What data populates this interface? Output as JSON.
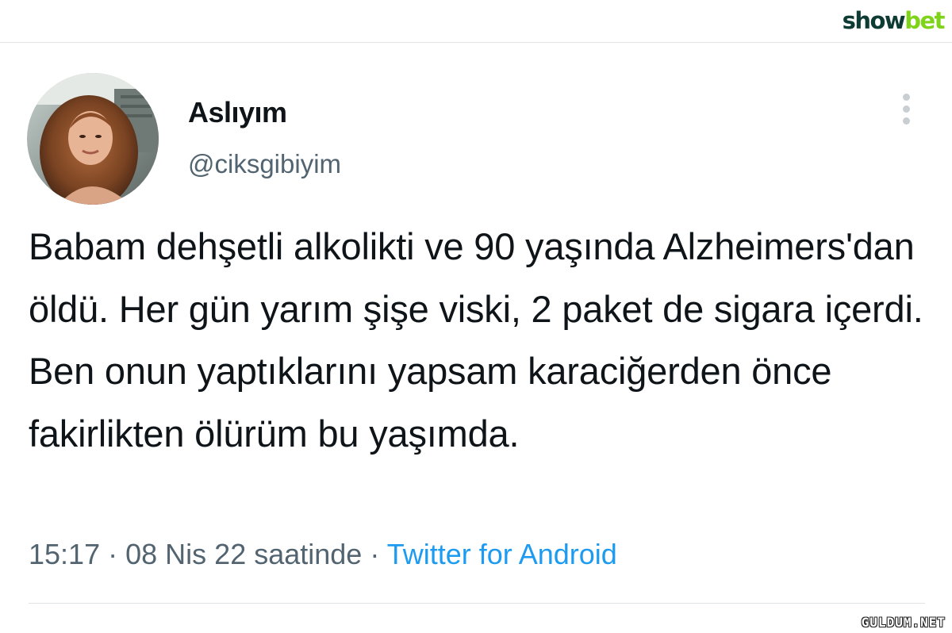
{
  "brand": {
    "logo_part1": "show",
    "logo_part2": "bet",
    "color_dark": "#0e3b34",
    "color_accent": "#7fd318"
  },
  "tweet": {
    "display_name": "Aslıyım",
    "handle": "@ciksgibiyim",
    "avatar": "profile-photo",
    "text": "Babam dehşetli alkolikti ve 90 yaşında Alzheimers'dan öldü. Her gün yarım şişe viski, 2 paket de sigara içerdi. Ben onun yaptıklarını yapsam karaciğerden önce fakirlikten ölürüm bu yaşımda.",
    "time": "15:17",
    "date": "08 Nis 22 saatinde",
    "separator": "·",
    "source": "Twitter for Android",
    "more_icon": "more-vertical-icon"
  },
  "colors": {
    "text": "#0f1419",
    "secondary": "#536471",
    "link": "#1d9bf0"
  },
  "watermark": "GULDUM.NET"
}
